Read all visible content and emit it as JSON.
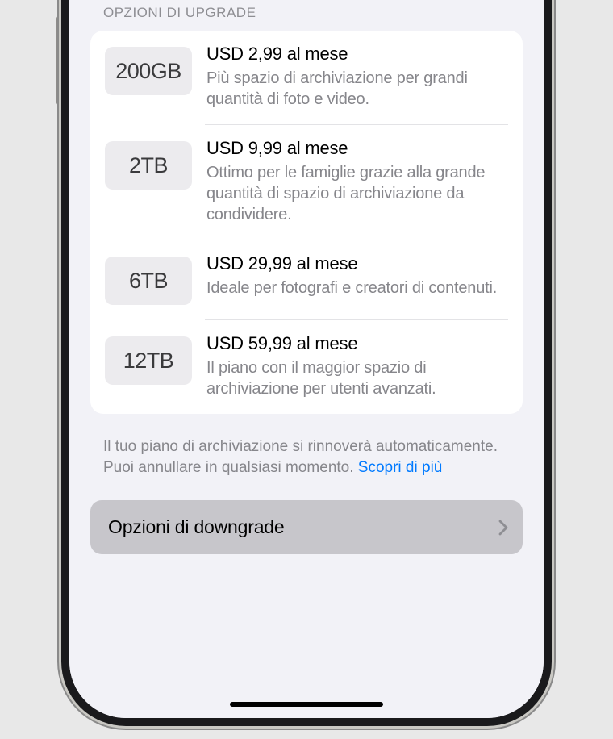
{
  "sectionHeader": "OPZIONI DI UPGRADE",
  "plans": [
    {
      "size": "200GB",
      "price": "USD 2,99 al mese",
      "desc": "Più spazio di archiviazione per grandi quantità di foto e video."
    },
    {
      "size": "2TB",
      "price": "USD 9,99 al mese",
      "desc": "Ottimo per le famiglie grazie alla grande quantità di spazio di archiviazione da condividere."
    },
    {
      "size": "6TB",
      "price": "USD 29,99 al mese",
      "desc": "Ideale per fotografi e creatori di contenuti."
    },
    {
      "size": "12TB",
      "price": "USD 59,99 al mese",
      "desc": "Il piano con il maggior spazio di archiviazione per utenti avanzati."
    }
  ],
  "footer": {
    "text": "Il tuo piano di archiviazione si rinnoverà automaticamente. Puoi annullare in qualsiasi momento. ",
    "link": "Scopri di più"
  },
  "downgrade": {
    "label": "Opzioni di downgrade"
  }
}
